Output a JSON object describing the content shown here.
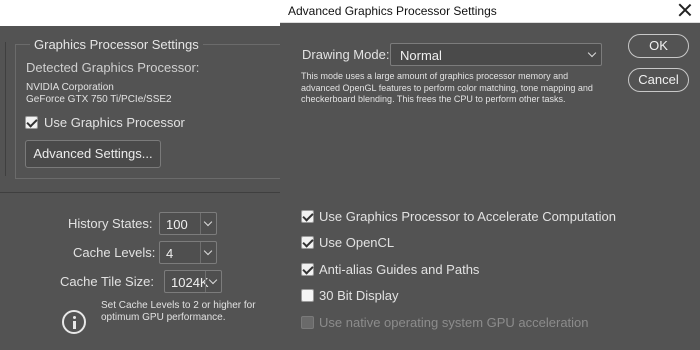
{
  "background_window": {
    "group_title": "Graphics Processor Settings",
    "detected_label": "Detected Graphics Processor:",
    "gpu_vendor": "NVIDIA Corporation",
    "gpu_model": "GeForce GTX 750 Ti/PCIe/SSE2",
    "use_gpu_label": "Use Graphics Processor",
    "use_gpu_checked": true,
    "advanced_button": "Advanced Settings...",
    "history_states_label": "History States:",
    "history_states_value": "100",
    "cache_levels_label": "Cache Levels:",
    "cache_levels_value": "4",
    "cache_tile_label": "Cache Tile Size:",
    "cache_tile_value": "1024K",
    "info_line1": "Set Cache Levels to 2 or higher for",
    "info_line2": "optimum GPU performance."
  },
  "dialog": {
    "title": "Advanced Graphics Processor Settings",
    "drawing_mode_label": "Drawing Mode:",
    "drawing_mode_value": "Normal",
    "description": "This mode uses a large amount of graphics processor memory and advanced OpenGL features to perform color matching, tone mapping and checkerboard blending.  This frees the CPU to perform other tasks.",
    "ok_button": "OK",
    "cancel_button": "Cancel",
    "options": [
      {
        "label": "Use Graphics Processor to Accelerate Computation",
        "checked": true,
        "enabled": true
      },
      {
        "label": "Use OpenCL",
        "checked": true,
        "enabled": true
      },
      {
        "label": "Anti-alias Guides and Paths",
        "checked": true,
        "enabled": true
      },
      {
        "label": "30 Bit Display",
        "checked": false,
        "enabled": true
      },
      {
        "label": "Use native operating system GPU acceleration",
        "checked": false,
        "enabled": false
      }
    ]
  }
}
